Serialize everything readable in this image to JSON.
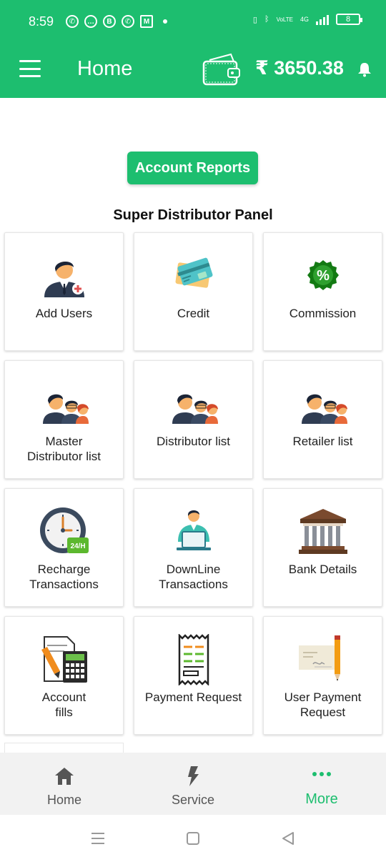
{
  "status_bar": {
    "time": "8:59",
    "battery": "8",
    "network_label": "4G",
    "volte_label": "VoLTE"
  },
  "header": {
    "title": "Home",
    "balance": "₹ 3650.38",
    "background_color": "#1dbe6f"
  },
  "main": {
    "reports_button": "Account Reports",
    "panel_title": "Super Distributor Panel",
    "cards": [
      {
        "label": "Add Users",
        "icon": "add-user-icon"
      },
      {
        "label": "Credit",
        "icon": "credit-card-icon"
      },
      {
        "label": "Commission",
        "icon": "percent-badge-icon"
      },
      {
        "label": "Master\nDistributor list",
        "icon": "user-group-icon"
      },
      {
        "label": "Distributor list",
        "icon": "user-group-icon"
      },
      {
        "label": "Retailer list",
        "icon": "user-group-icon"
      },
      {
        "label": "Recharge\nTransactions",
        "icon": "clock-24h-icon"
      },
      {
        "label": "DownLine\nTransactions",
        "icon": "person-laptop-icon"
      },
      {
        "label": "Bank Details",
        "icon": "bank-icon"
      },
      {
        "label": "Account\nfills",
        "icon": "calculator-document-icon"
      },
      {
        "label": "Payment Request",
        "icon": "receipt-icon"
      },
      {
        "label": "User Payment\nRequest",
        "icon": "cheque-pencil-icon"
      }
    ]
  },
  "bottom_nav": {
    "items": [
      {
        "label": "Home",
        "icon": "home-icon"
      },
      {
        "label": "Service",
        "icon": "lightning-icon"
      },
      {
        "label": "More",
        "icon": "more-dots-icon"
      }
    ],
    "active_index": 2,
    "active_color": "#1dbe6f"
  }
}
